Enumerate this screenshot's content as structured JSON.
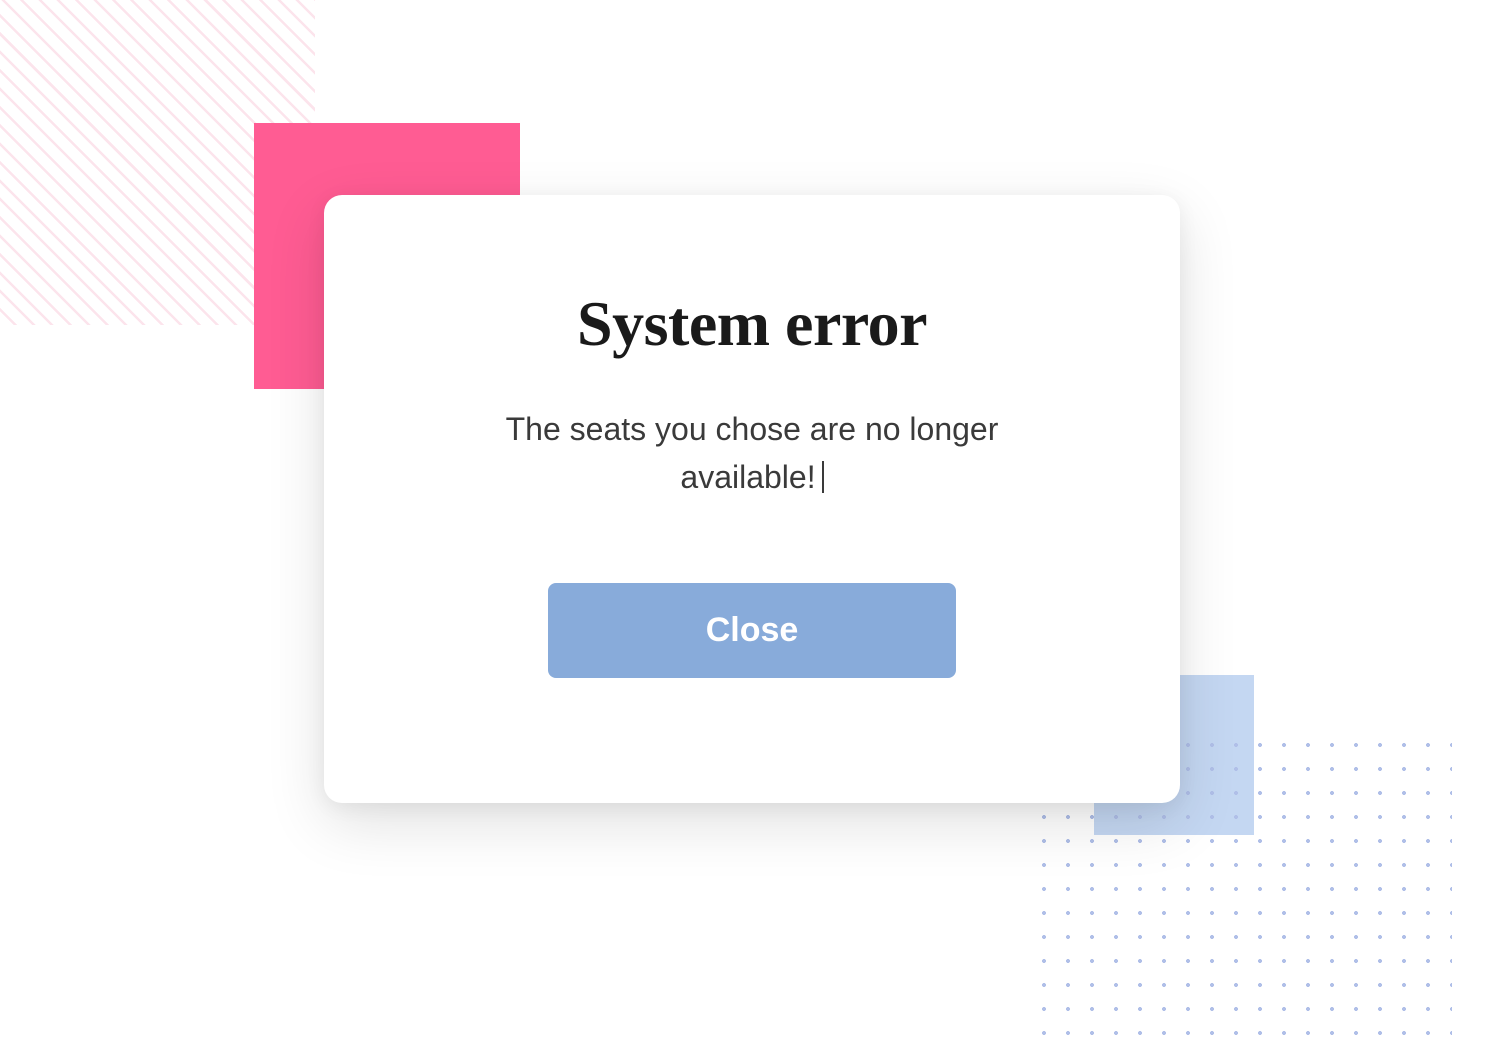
{
  "modal": {
    "title": "System error",
    "message": "The seats you chose are no longer available!",
    "close_label": "Close"
  },
  "colors": {
    "accent_pink": "#ff5c93",
    "accent_blue": "#88abda",
    "light_blue": "#c4d7f2"
  }
}
